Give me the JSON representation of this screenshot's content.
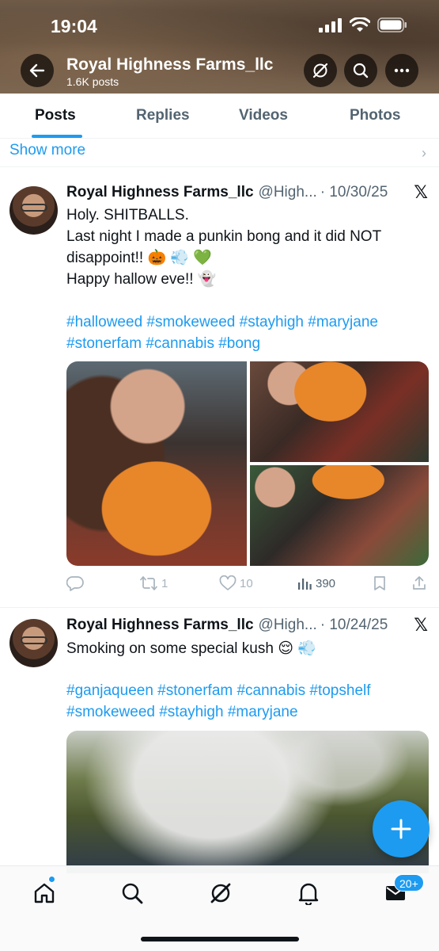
{
  "status_bar": {
    "time": "19:04"
  },
  "profile": {
    "name": "Royal Highness Farms_llc",
    "posts_count": "1.6K posts"
  },
  "header_icons": [
    "back-arrow-icon",
    "grok-icon",
    "search-icon",
    "more-icon"
  ],
  "tabs": [
    {
      "label": "Posts",
      "active": true
    },
    {
      "label": "Replies",
      "active": false
    },
    {
      "label": "Videos",
      "active": false
    },
    {
      "label": "Photos",
      "active": false
    }
  ],
  "show_more": "Show more",
  "tweets": [
    {
      "name": "Royal Highness Farms_llc",
      "handle": "@High...",
      "date": "· 10/30/25",
      "lines": [
        "Holy. SHITBALLS.",
        "Last night I made a punkin bong and it did NOT disappoint!! 🎃 💨 💚",
        "Happy hallow eve!! 👻"
      ],
      "hashtags": "#halloweed #smokeweed #stayhigh #maryjane #stonerfam #cannabis #bong",
      "actions": {
        "replies": "",
        "reposts": "1",
        "likes": "10",
        "views": "390"
      }
    },
    {
      "name": "Royal Highness Farms_llc",
      "handle": "@High...",
      "date": "· 10/24/25",
      "lines": [
        "Smoking on some special kush 😌 💨"
      ],
      "hashtags": "#ganjaqueen #stonerfam #cannabis #topshelf #smokeweed #stayhigh #maryjane"
    }
  ],
  "bottom_nav": [
    "home-icon",
    "search-icon",
    "grok-icon",
    "notifications-icon",
    "messages-icon"
  ],
  "messages_badge": "20+",
  "colors": {
    "accent": "#1d9bf0",
    "text": "#0f1419",
    "secondary": "#536471"
  }
}
